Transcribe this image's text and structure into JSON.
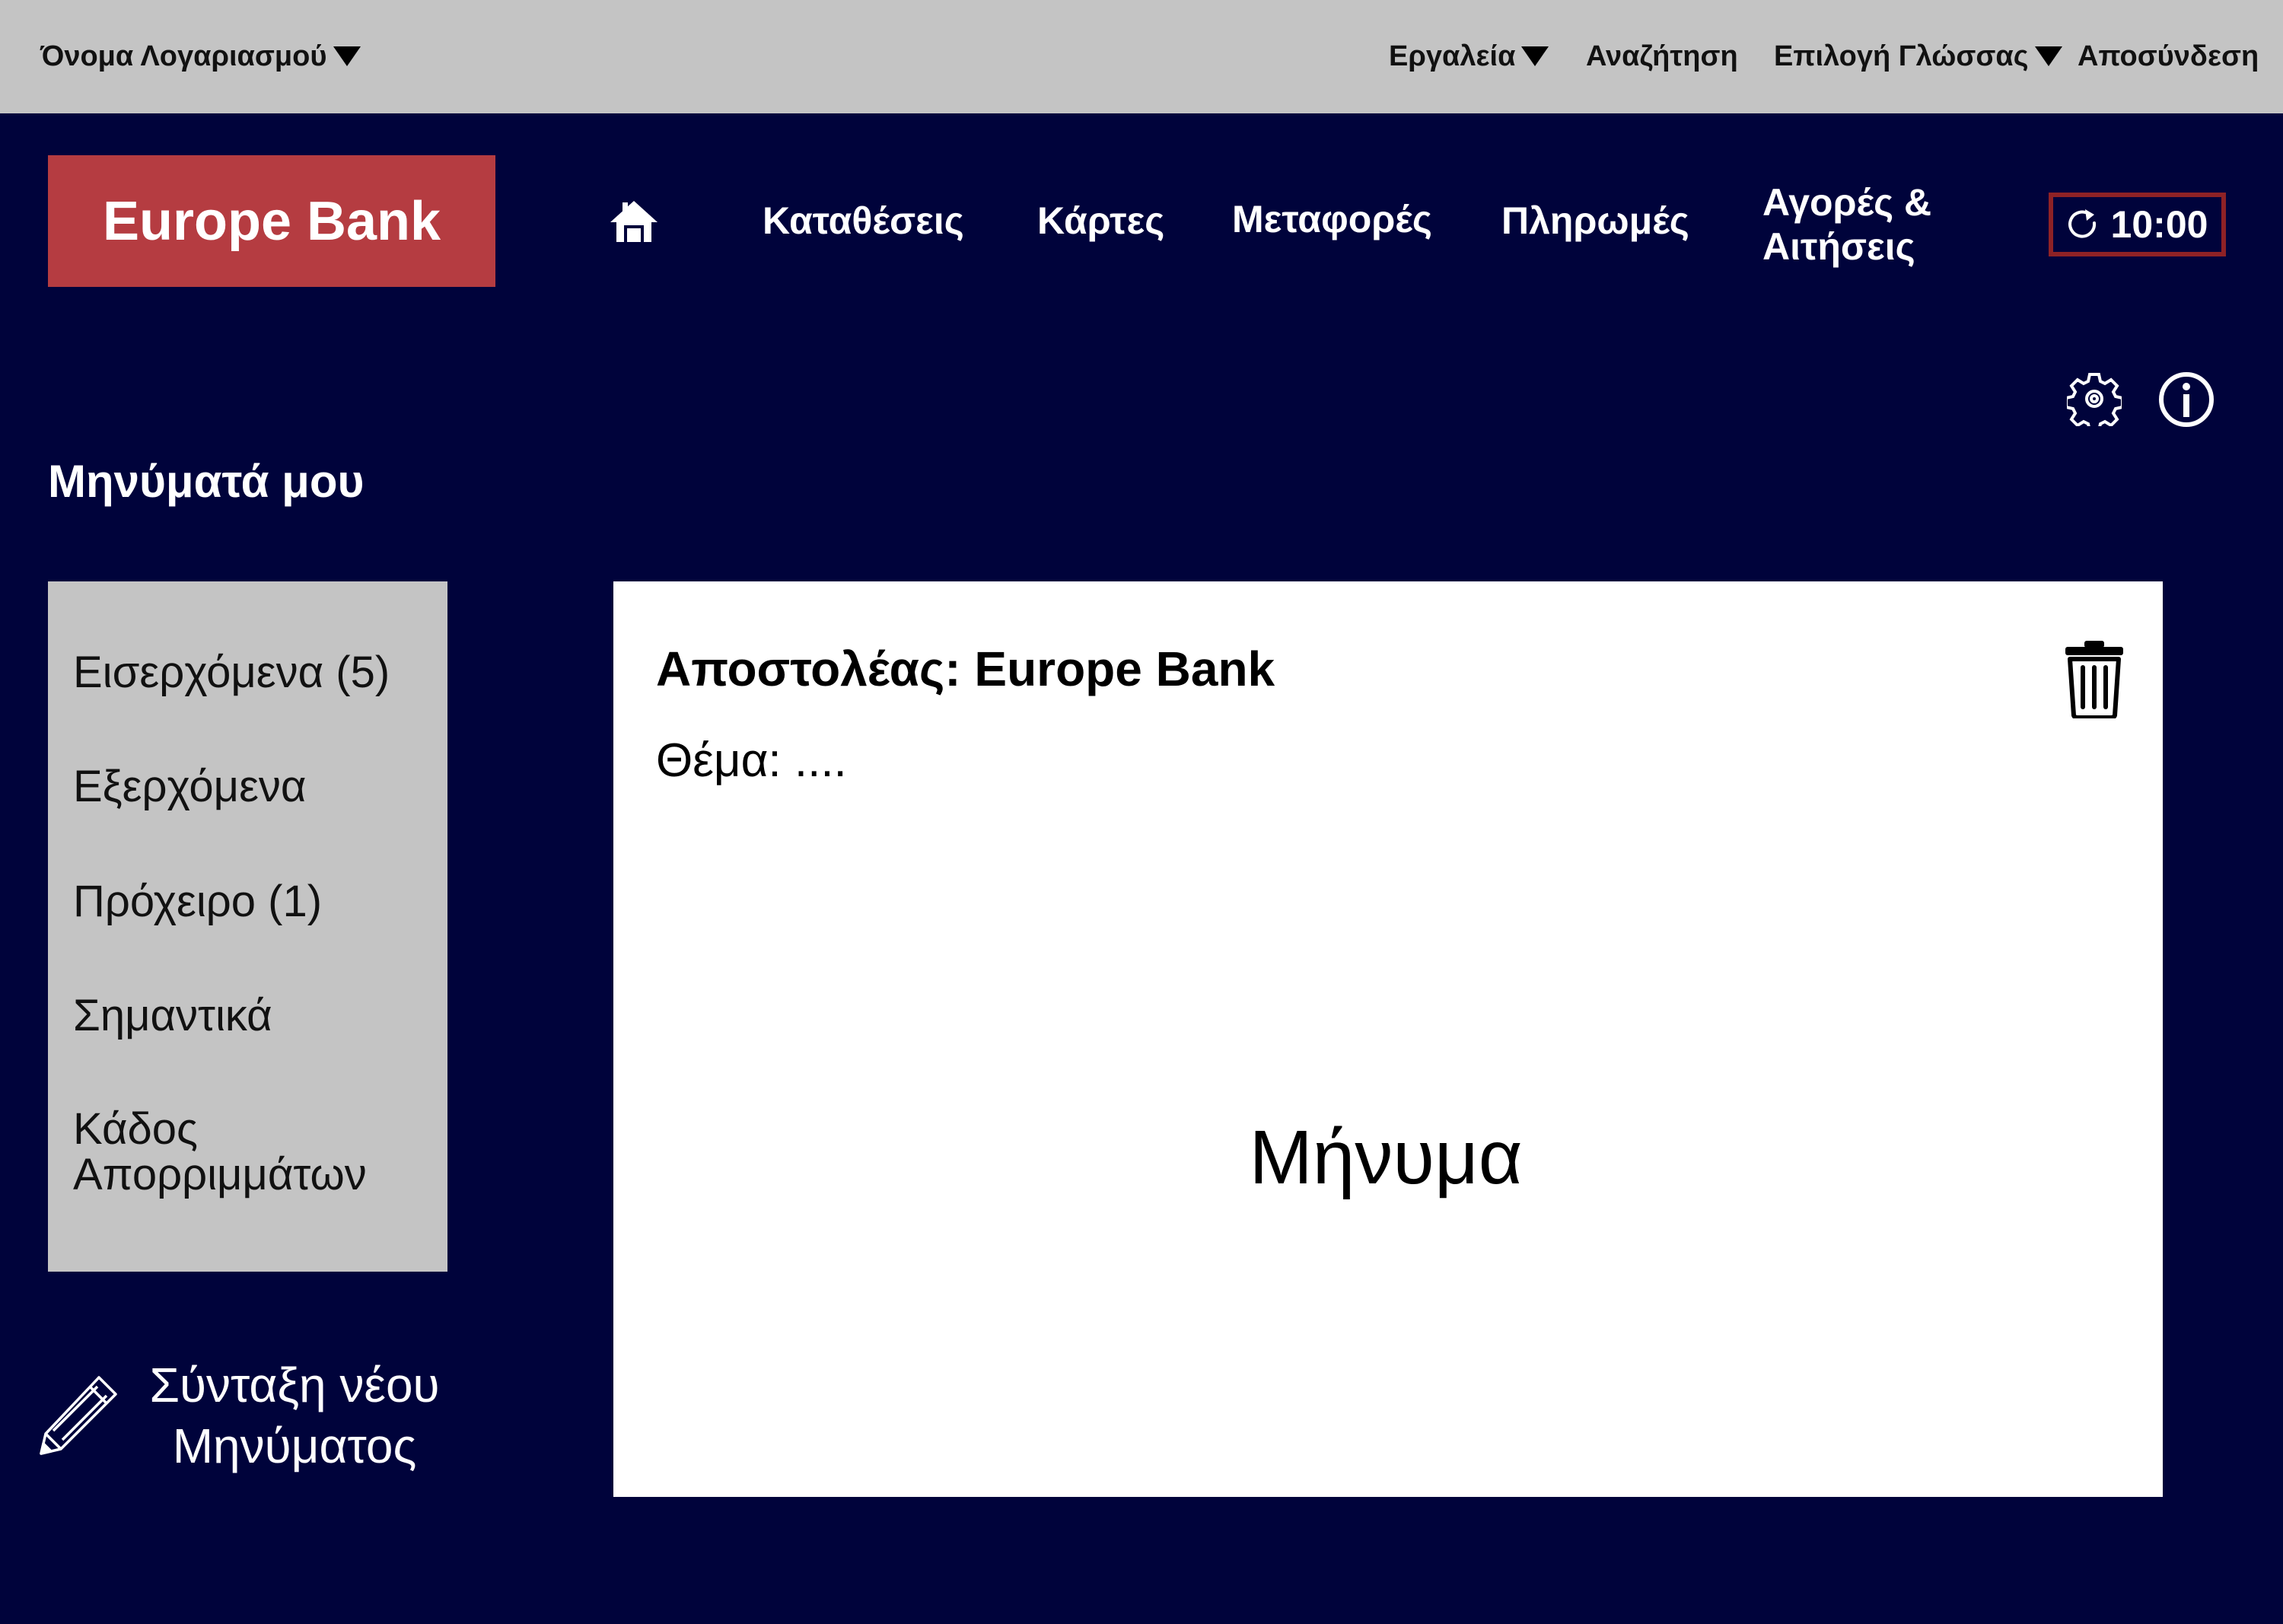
{
  "topbar": {
    "account_name": "Όνομα Λογαριασμού",
    "tools": "Εργαλεία",
    "search": "Αναζήτηση",
    "language": "Επιλογή Γλώσσας",
    "logout": "Αποσύνδεση"
  },
  "brand": {
    "name": "Europe Bank",
    "color": "#b53c41"
  },
  "nav": {
    "home_icon": "home-icon",
    "deposits": "Καταθέσεις",
    "cards": "Κάρτες",
    "transfers": "Μεταφορές",
    "payments": "Πληρωμές",
    "purchases_line1": "Αγορές &",
    "purchases_line2": "Αιτήσεις"
  },
  "session": {
    "timer": "10:00",
    "icon": "refresh-icon",
    "border_color": "#8e2226"
  },
  "utility_icons": [
    "gear-icon",
    "info-icon"
  ],
  "page": {
    "title": "Μηνύματά μου"
  },
  "sidebar": {
    "folders": [
      {
        "label": "Εισερχόμενα (5)"
      },
      {
        "label": "Εξερχόμενα"
      },
      {
        "label": "Πρόχειρο (1)"
      },
      {
        "label": "Σημαντικά"
      },
      {
        "label_line1": "Κάδος",
        "label_line2": "Απορριμμάτων"
      }
    ]
  },
  "compose": {
    "icon": "pencil-icon",
    "label_line1": "Σύνταξη νέου",
    "label_line2": "Μηνύματος"
  },
  "message": {
    "sender": "Αποστολέας: Europe Bank",
    "subject": "Θέμα: ....",
    "body": "Μήνυμα",
    "delete_icon": "trash-icon"
  },
  "colors": {
    "background": "#00033b",
    "topbar": "#c4c4c4",
    "sidebar": "#c4c4c4",
    "panel": "#ffffff"
  }
}
